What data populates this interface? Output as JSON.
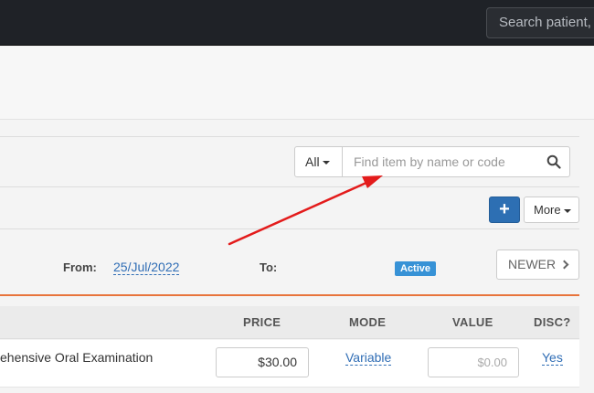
{
  "topbar": {
    "search_placeholder": "Search patient, c"
  },
  "filter": {
    "scope": "All",
    "search_placeholder": "Find item by name or code"
  },
  "actions": {
    "add_label": "+",
    "more_label": "More"
  },
  "range": {
    "from_label": "From:",
    "from_date": "25/Jul/2022",
    "to_label": "To:",
    "status_badge": "Active",
    "newer_label": "NEWER"
  },
  "table": {
    "headers": {
      "price": "PRICE",
      "mode": "MODE",
      "value": "VALUE",
      "disc": "DISC?"
    },
    "rows": [
      {
        "description": "ehensive Oral Examination",
        "price": "$30.00",
        "mode": "Variable",
        "value_placeholder": "$0.00",
        "disc": "Yes"
      }
    ]
  },
  "annotation": {
    "arrow_color": "#e31b1b"
  },
  "colors": {
    "accent": "#2d6fb3",
    "link": "#2f6db5",
    "badge": "#3792d6",
    "divider": "#e8743b"
  }
}
